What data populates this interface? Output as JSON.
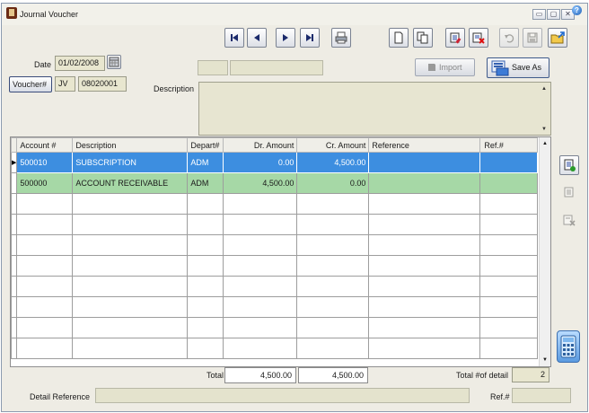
{
  "window": {
    "title": "Journal Voucher",
    "icon": "accounting-book-icon"
  },
  "window_controls": {
    "minimize": "▭",
    "maximize": "▢",
    "close": "✕",
    "help": "?"
  },
  "toolbar": {
    "icons": [
      "first-record-icon",
      "previous-record-icon",
      "next-record-icon",
      "last-record-icon",
      "print-icon",
      "new-icon",
      "copy-icon",
      "edit-icon",
      "delete-icon",
      "undo-icon",
      "save-icon",
      "export-icon"
    ]
  },
  "header": {
    "date_label": "Date",
    "date_value": "01/02/2008",
    "voucher_button": "Voucher#",
    "voucher_type": "JV",
    "voucher_number": "08020001",
    "description_label": "Description",
    "import_label": "Import",
    "save_as_label": "Save As"
  },
  "grid": {
    "columns": [
      "Account #",
      "Description",
      "Depart#",
      "Dr. Amount",
      "Cr. Amount",
      "Reference",
      "Ref.#"
    ],
    "rows": [
      {
        "account": "500010",
        "description": "SUBSCRIPTION",
        "depart": "ADM",
        "dr": "0.00",
        "cr": "4,500.00",
        "reference": "",
        "ref_no": ""
      },
      {
        "account": "500000",
        "description": "ACCOUNT RECEIVABLE",
        "depart": "ADM",
        "dr": "4,500.00",
        "cr": "0.00",
        "reference": "",
        "ref_no": ""
      }
    ],
    "selected_row_color": "#3d8ee0",
    "second_row_color": "#a6d8a6"
  },
  "totals": {
    "total_label": "Total",
    "total_dr": "4,500.00",
    "total_cr": "4,500.00",
    "detail_count_label": "Total #of detail",
    "detail_count": "2"
  },
  "footer": {
    "detail_reference_label": "Detail Reference",
    "ref_label": "Ref.#"
  }
}
